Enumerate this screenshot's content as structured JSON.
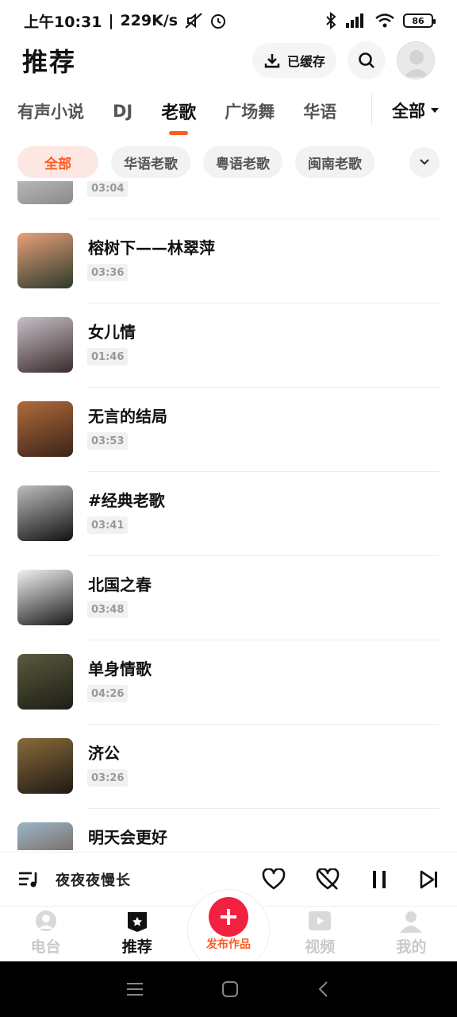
{
  "status_bar": {
    "time": "上午10:31",
    "speed": "229K/s",
    "battery": "86"
  },
  "header": {
    "title": "推荐",
    "cached_label": "已缓存"
  },
  "category_tabs": [
    {
      "label": "有声小说",
      "active": false
    },
    {
      "label": "DJ",
      "active": false
    },
    {
      "label": "老歌",
      "active": true
    },
    {
      "label": "广场舞",
      "active": false
    },
    {
      "label": "华语",
      "active": false
    }
  ],
  "category_all": "全部",
  "chips": [
    {
      "label": "全部",
      "active": true
    },
    {
      "label": "华语老歌",
      "active": false
    },
    {
      "label": "粤语老歌",
      "active": false
    },
    {
      "label": "闽南老歌",
      "active": false
    }
  ],
  "songs": [
    {
      "title": "",
      "duration": "03:04",
      "thumb_colors": [
        "#d9d9d9",
        "#8a8a8a"
      ]
    },
    {
      "title": "榕树下——林翠萍",
      "duration": "03:36",
      "thumb_colors": [
        "#e8a07a",
        "#2c3a2a"
      ]
    },
    {
      "title": "女儿情",
      "duration": "01:46",
      "thumb_colors": [
        "#c7c0c8",
        "#3b2b2b"
      ]
    },
    {
      "title": "无言的结局",
      "duration": "03:53",
      "thumb_colors": [
        "#b06b3c",
        "#3a2418"
      ]
    },
    {
      "title": "#经典老歌",
      "duration": "03:41",
      "thumb_colors": [
        "#bdbdbd",
        "#111111"
      ]
    },
    {
      "title": "北国之春",
      "duration": "03:48",
      "thumb_colors": [
        "#f2f2f2",
        "#1a1a1a"
      ]
    },
    {
      "title": "单身情歌",
      "duration": "04:26",
      "thumb_colors": [
        "#5a5a3e",
        "#1d1d16"
      ]
    },
    {
      "title": "济公",
      "duration": "03:26",
      "thumb_colors": [
        "#8a6a3a",
        "#1e1a14"
      ]
    },
    {
      "title": "明天会更好",
      "duration": "",
      "thumb_colors": [
        "#9ab7c7",
        "#6a4a3a"
      ]
    }
  ],
  "now_playing": {
    "title": "夜夜夜慢长"
  },
  "bottom_nav": [
    {
      "label": "电台",
      "active": false
    },
    {
      "label": "推荐",
      "active": true
    },
    {
      "label": "发布作品",
      "active": false
    },
    {
      "label": "视频",
      "active": false
    },
    {
      "label": "我的",
      "active": false
    }
  ],
  "colors": {
    "accent": "#ff5a1f",
    "publish": "#f2213f"
  }
}
